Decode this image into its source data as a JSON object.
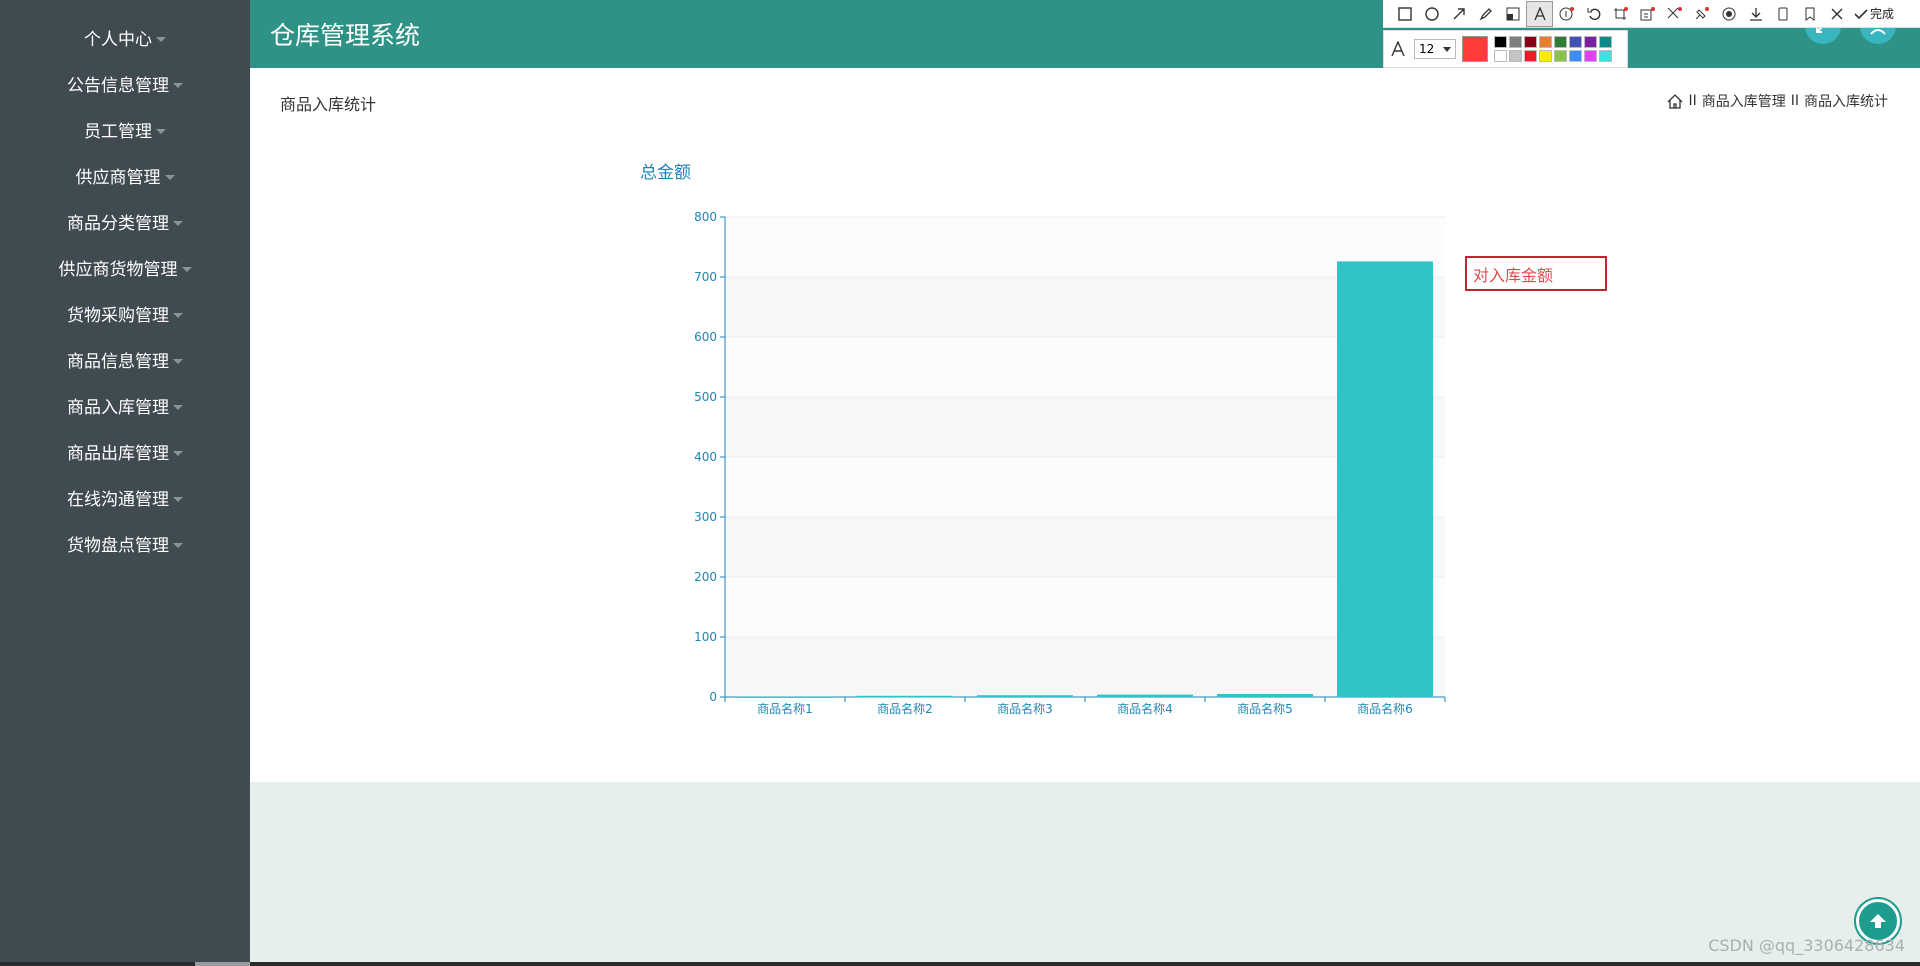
{
  "app": {
    "title": "仓库管理系统"
  },
  "sidebar": {
    "items": [
      {
        "label": "个人中心"
      },
      {
        "label": "公告信息管理"
      },
      {
        "label": "员工管理"
      },
      {
        "label": "供应商管理"
      },
      {
        "label": "商品分类管理"
      },
      {
        "label": "供应商货物管理"
      },
      {
        "label": "货物采购管理"
      },
      {
        "label": "商品信息管理"
      },
      {
        "label": "商品入库管理"
      },
      {
        "label": "商品出库管理"
      },
      {
        "label": "在线沟通管理"
      },
      {
        "label": "货物盘点管理"
      }
    ]
  },
  "page": {
    "title": "商品入库统计",
    "breadcrumb": {
      "separator": "II",
      "items": [
        "商品入库管理",
        "商品入库统计"
      ]
    }
  },
  "screenshot_tool": {
    "done_label": "完成",
    "font_size": "12",
    "current_color": "#ff3b3b",
    "palette": [
      "#000000",
      "#7f7f7f",
      "#880015",
      "#ed7d31",
      "#2e7d32",
      "#3f51b5",
      "#7b1fa2",
      "#0b8a8a",
      "#ffffff",
      "#c3c3c3",
      "#ed1c24",
      "#ffeb00",
      "#8bc34a",
      "#3d8bfd",
      "#e040fb",
      "#40e0e0"
    ]
  },
  "annotation": {
    "text": "对入库金额"
  },
  "watermark": "CSDN @qq_3306428634",
  "colors": {
    "sidebar_bg": "#404a51",
    "header_bg": "#2e9386",
    "bar": "#2ec4c6",
    "axis": "#1e86b4"
  },
  "chart_data": {
    "type": "bar",
    "title": "总金额",
    "categories": [
      "商品名称1",
      "商品名称2",
      "商品名称3",
      "商品名称4",
      "商品名称5",
      "商品名称6"
    ],
    "values": [
      1,
      2,
      3,
      4,
      5,
      726
    ],
    "ylim": [
      0,
      800
    ],
    "yticks": [
      0,
      100,
      200,
      300,
      400,
      500,
      600,
      700,
      800
    ],
    "grid": true,
    "legend": "none"
  }
}
